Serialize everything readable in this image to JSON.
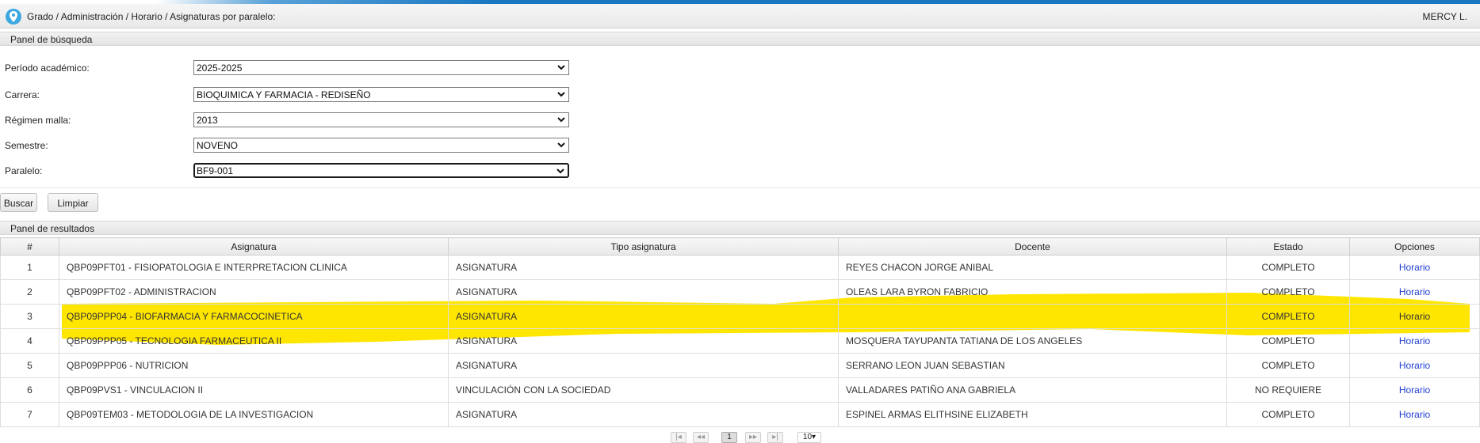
{
  "header": {
    "breadcrumb": "Grado / Administración / Horario / Asignaturas por paralelo:",
    "user": "MERCY L."
  },
  "search_panel": {
    "title": "Panel de búsqueda",
    "fields": [
      {
        "label": "Período académico:",
        "value": "2025-2025"
      },
      {
        "label": "Carrera:",
        "value": "BIOQUIMICA Y FARMACIA - REDISEÑO"
      },
      {
        "label": "Régimen malla:",
        "value": "2013"
      },
      {
        "label": "Semestre:",
        "value": "NOVENO"
      },
      {
        "label": "Paralelo:",
        "value": "BF9-001"
      }
    ],
    "buttons": {
      "search": "Buscar",
      "clear": "Limpiar"
    }
  },
  "results_panel": {
    "title": "Panel de resultados",
    "columns": [
      "#",
      "Asignatura",
      "Tipo asignatura",
      "Docente",
      "Estado",
      "Opciones"
    ],
    "rows": [
      {
        "n": "1",
        "asignatura": "QBP09PFT01 - FISIOPATOLOGIA E INTERPRETACION CLINICA",
        "tipo": "ASIGNATURA",
        "docente": "REYES CHACON JORGE ANIBAL",
        "estado": "COMPLETO",
        "opcion": "Horario"
      },
      {
        "n": "2",
        "asignatura": "QBP09PFT02 - ADMINISTRACION",
        "tipo": "ASIGNATURA",
        "docente": "OLEAS LARA BYRON FABRICIO",
        "estado": "COMPLETO",
        "opcion": "Horario"
      },
      {
        "n": "3",
        "asignatura": "QBP09PPP04 - BIOFARMACIA Y FARMACOCINETICA",
        "tipo": "ASIGNATURA",
        "docente": "",
        "estado": "COMPLETO",
        "opcion": "Horario"
      },
      {
        "n": "4",
        "asignatura": "QBP09PPP05 - TECNOLOGIA FARMACEUTICA II",
        "tipo": "ASIGNATURA",
        "docente": "MOSQUERA TAYUPANTA TATIANA DE LOS ANGELES",
        "estado": "COMPLETO",
        "opcion": "Horario"
      },
      {
        "n": "5",
        "asignatura": "QBP09PPP06 - NUTRICION",
        "tipo": "ASIGNATURA",
        "docente": "SERRANO LEON JUAN SEBASTIAN",
        "estado": "COMPLETO",
        "opcion": "Horario"
      },
      {
        "n": "6",
        "asignatura": "QBP09PVS1 - VINCULACION II",
        "tipo": "VINCULACIÓN CON LA SOCIEDAD",
        "docente": "VALLADARES PATIÑO ANA GABRIELA",
        "estado": "NO REQUIERE",
        "opcion": "Horario"
      },
      {
        "n": "7",
        "asignatura": "QBP09TEM03 - METODOLOGIA DE LA INVESTIGACION",
        "tipo": "ASIGNATURA",
        "docente": "ESPINEL ARMAS ELITHSINE ELIZABETH",
        "estado": "COMPLETO",
        "opcion": "Horario"
      }
    ]
  },
  "pagination": {
    "current_page": "1",
    "page_size": "10"
  },
  "colors": {
    "accent": "#1a78c2",
    "link": "#1f3fd0",
    "highlight": "#ffe600"
  },
  "icons": [
    "location-pin-icon",
    "chevron-down-icon",
    "first-page-icon",
    "prev-page-icon",
    "next-page-icon",
    "last-page-icon"
  ]
}
